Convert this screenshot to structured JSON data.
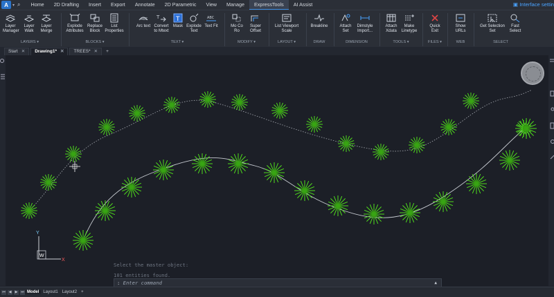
{
  "menu": {
    "logo": "A",
    "items": [
      "Home",
      "2D Drafting",
      "Insert",
      "Export",
      "Annotate",
      "2D Parametric",
      "View",
      "Manage",
      "ExpressTools",
      "AI Assist"
    ],
    "active": "ExpressTools",
    "interface_settings": "Interface settin"
  },
  "ribbon": {
    "tools": {
      "layer_manager": "Layer\nManager",
      "layer_walk": "Layer\nWalk",
      "layer_merge": "Layer\nMerge",
      "explode_attributes": "Explode\nAttributes",
      "replace_block": "Replace\nBlock",
      "list_properties": "List\nProperties",
      "arc_text": "Arc text",
      "convert_to_mtext": "Convert\nto Mtext",
      "mask": "Mask",
      "explode_text": "Explode\nText",
      "text_fit": "Text Fit",
      "mo_co_ro": "Mo Co\nRo",
      "super_offset": "Super\nOffset",
      "list_viewport_scale": "List Viewport\nScale",
      "breakline": "Breakline",
      "attach_set": "Attach\nSet",
      "dimstyle_import": "Dimstyle\nImport...",
      "attach_xdata": "Attach\nXdata",
      "make_linetype": "Make\nLinetype",
      "quick_exit": "Quick\nExit",
      "show_urls": "Show\nURLs",
      "get_selection_set": "Get Selection\nSet",
      "fast_select": "Fast\nSelect"
    },
    "groups": {
      "layers": "LAYERS",
      "blocks": "BLOCKS",
      "text": "TEXT",
      "modify": "MODIFY",
      "layout": "LAYOUT",
      "draw": "DRAW",
      "dimension": "DIMENSION",
      "tools": "TOOLS",
      "files": "FILES",
      "web": "WEB",
      "select": "SELECT"
    }
  },
  "doc_tabs": [
    {
      "label": "Start"
    },
    {
      "label": "Drawing1*"
    },
    {
      "label": "TREES*"
    }
  ],
  "ucs": {
    "y_label": "Y",
    "w_label": "W",
    "x_label": "X"
  },
  "command": {
    "history": [
      "Select the master object:",
      "101 entities found."
    ],
    "prompt_lead": ":",
    "placeholder": "Enter command"
  },
  "layout_tabs": [
    "Model",
    "Layout1",
    "Layout2"
  ],
  "colors": {
    "accent": "#3b8de6",
    "tree_green": "#4fdc1c",
    "background": "#1c1f27"
  }
}
